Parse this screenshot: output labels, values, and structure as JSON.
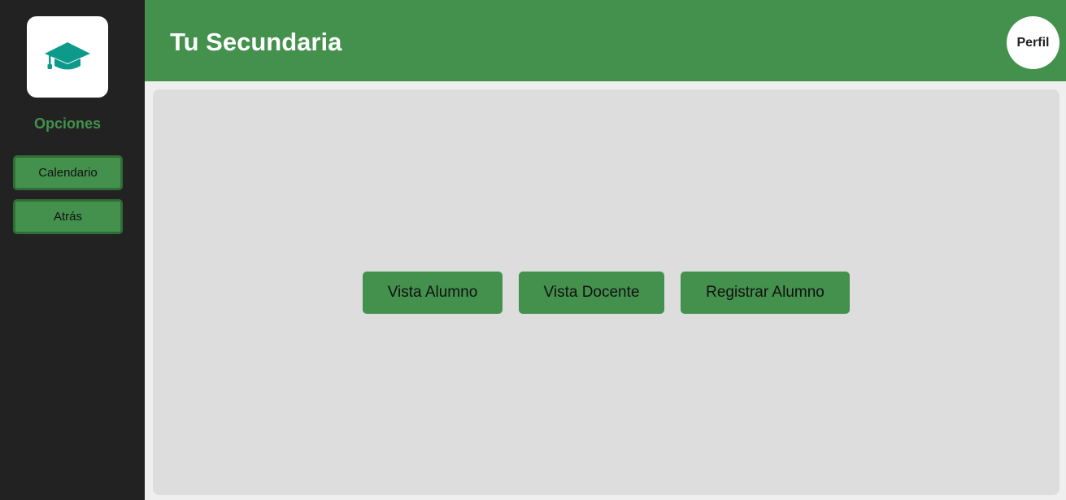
{
  "sidebar": {
    "logo_icon": "graduation-cap-icon",
    "logo_color": "#0e9a8a",
    "title": "Opciones",
    "items": [
      {
        "label": "Calendario"
      },
      {
        "label": "Atrás"
      }
    ]
  },
  "header": {
    "title": "Tu Secundaria",
    "profile_label": "Perfil"
  },
  "main": {
    "buttons": [
      {
        "label": "Vista Alumno"
      },
      {
        "label": "Vista Docente"
      },
      {
        "label": "Registrar Alumno"
      }
    ]
  },
  "colors": {
    "accent": "#43914c",
    "sidebar_bg": "#222222",
    "panel_bg": "#dddddd"
  }
}
